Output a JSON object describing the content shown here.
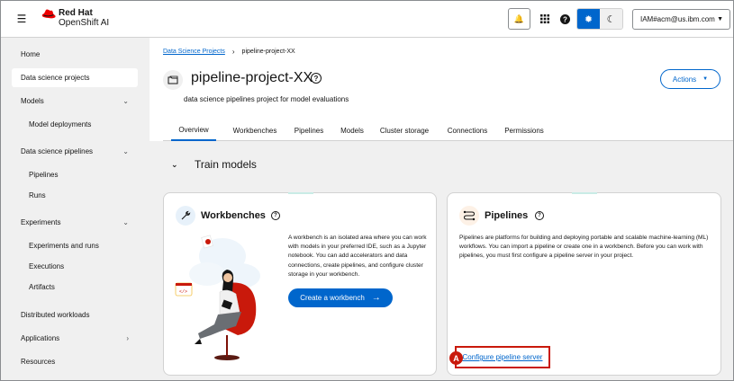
{
  "header": {
    "brand": "Red Hat",
    "product": "OpenShift AI",
    "user": "IAM#acm@us.ibm.com",
    "accent": "#0066cc"
  },
  "sidebar": {
    "items": [
      {
        "label": "Home"
      },
      {
        "label": "Data science projects"
      },
      {
        "label": "Models"
      },
      {
        "label": "Model deployments"
      },
      {
        "label": "Data science pipelines"
      },
      {
        "label": "Pipelines"
      },
      {
        "label": "Runs"
      },
      {
        "label": "Experiments"
      },
      {
        "label": "Experiments and runs"
      },
      {
        "label": "Executions"
      },
      {
        "label": "Artifacts"
      },
      {
        "label": "Distributed workloads"
      },
      {
        "label": "Applications"
      },
      {
        "label": "Resources"
      }
    ]
  },
  "breadcrumb": {
    "root": "Data Science Projects",
    "current": "pipeline-project-XX"
  },
  "project": {
    "title": "pipeline-project-XX",
    "description": "data science pipelines project for model evaluations",
    "actions_label": "Actions"
  },
  "tabs": [
    "Overview",
    "Workbenches",
    "Pipelines",
    "Models",
    "Cluster storage",
    "Connections",
    "Permissions"
  ],
  "section": {
    "title": "Train models"
  },
  "workbenches_card": {
    "title": "Workbenches",
    "body": "A workbench is an isolated area where you can work with models in your preferred IDE, such as a Jupyter notebook. You can add accelerators and data connections, create pipelines, and configure cluster storage in your workbench.",
    "button": "Create a workbench"
  },
  "pipelines_card": {
    "title": "Pipelines",
    "body": "Pipelines are platforms for building and deploying portable and scalable machine-learning (ML) workflows. You can import a pipeline or create one in a workbench. Before you can work with pipelines, you must first configure a pipeline server in your project.",
    "link": "Configure pipeline server",
    "marker": "A"
  }
}
